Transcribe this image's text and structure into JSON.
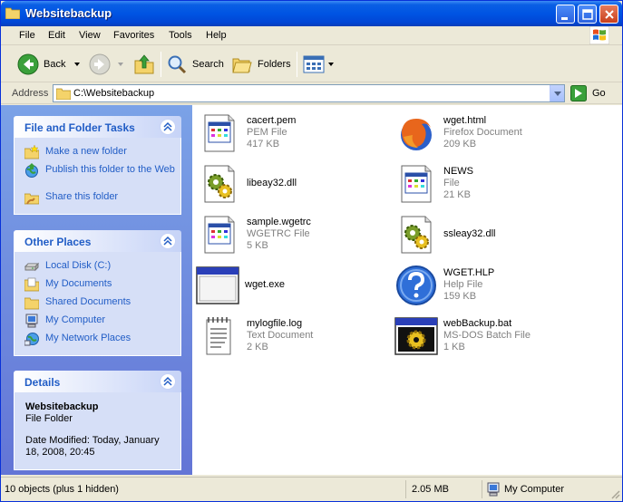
{
  "window": {
    "title": "Websitebackup"
  },
  "menu": [
    "File",
    "Edit",
    "View",
    "Favorites",
    "Tools",
    "Help"
  ],
  "toolbar": {
    "back": "Back",
    "search": "Search",
    "folders": "Folders"
  },
  "address": {
    "label": "Address",
    "value": "C:\\Websitebackup",
    "go": "Go"
  },
  "tasks": {
    "title": "File and Folder Tasks",
    "items": [
      "Make a new folder",
      "Publish this folder to the Web",
      "Share this folder"
    ]
  },
  "other_places": {
    "title": "Other Places",
    "items": [
      "Local Disk (C:)",
      "My Documents",
      "Shared Documents",
      "My Computer",
      "My Network Places"
    ]
  },
  "details": {
    "title": "Details",
    "name": "Websitebackup",
    "type": "File Folder",
    "modified": "Date Modified: Today, January 18, 2008, 20:45"
  },
  "files": [
    {
      "name": "cacert.pem",
      "type": "PEM File",
      "size": "417 KB",
      "icon": "document-icon"
    },
    {
      "name": "wget.html",
      "type": "Firefox Document",
      "size": "209 KB",
      "icon": "firefox-icon"
    },
    {
      "name": "libeay32.dll",
      "type": "",
      "size": "",
      "icon": "dll-gear-icon"
    },
    {
      "name": "NEWS",
      "type": "File",
      "size": "21 KB",
      "icon": "document-icon"
    },
    {
      "name": "sample.wgetrc",
      "type": "WGETRC File",
      "size": "5 KB",
      "icon": "document-icon"
    },
    {
      "name": "ssleay32.dll",
      "type": "",
      "size": "",
      "icon": "dll-gear-icon"
    },
    {
      "name": "wget.exe",
      "type": "",
      "size": "",
      "icon": "exe-window-icon"
    },
    {
      "name": "WGET.HLP",
      "type": "Help File",
      "size": "159 KB",
      "icon": "help-icon"
    },
    {
      "name": "mylogfile.log",
      "type": "Text Document",
      "size": "2 KB",
      "icon": "notepad-icon"
    },
    {
      "name": "webBackup.bat",
      "type": "MS-DOS Batch File",
      "size": "1 KB",
      "icon": "batch-gear-icon"
    }
  ],
  "status": {
    "objects": "10 objects (plus 1 hidden)",
    "size": "2.05 MB",
    "location": "My Computer"
  }
}
